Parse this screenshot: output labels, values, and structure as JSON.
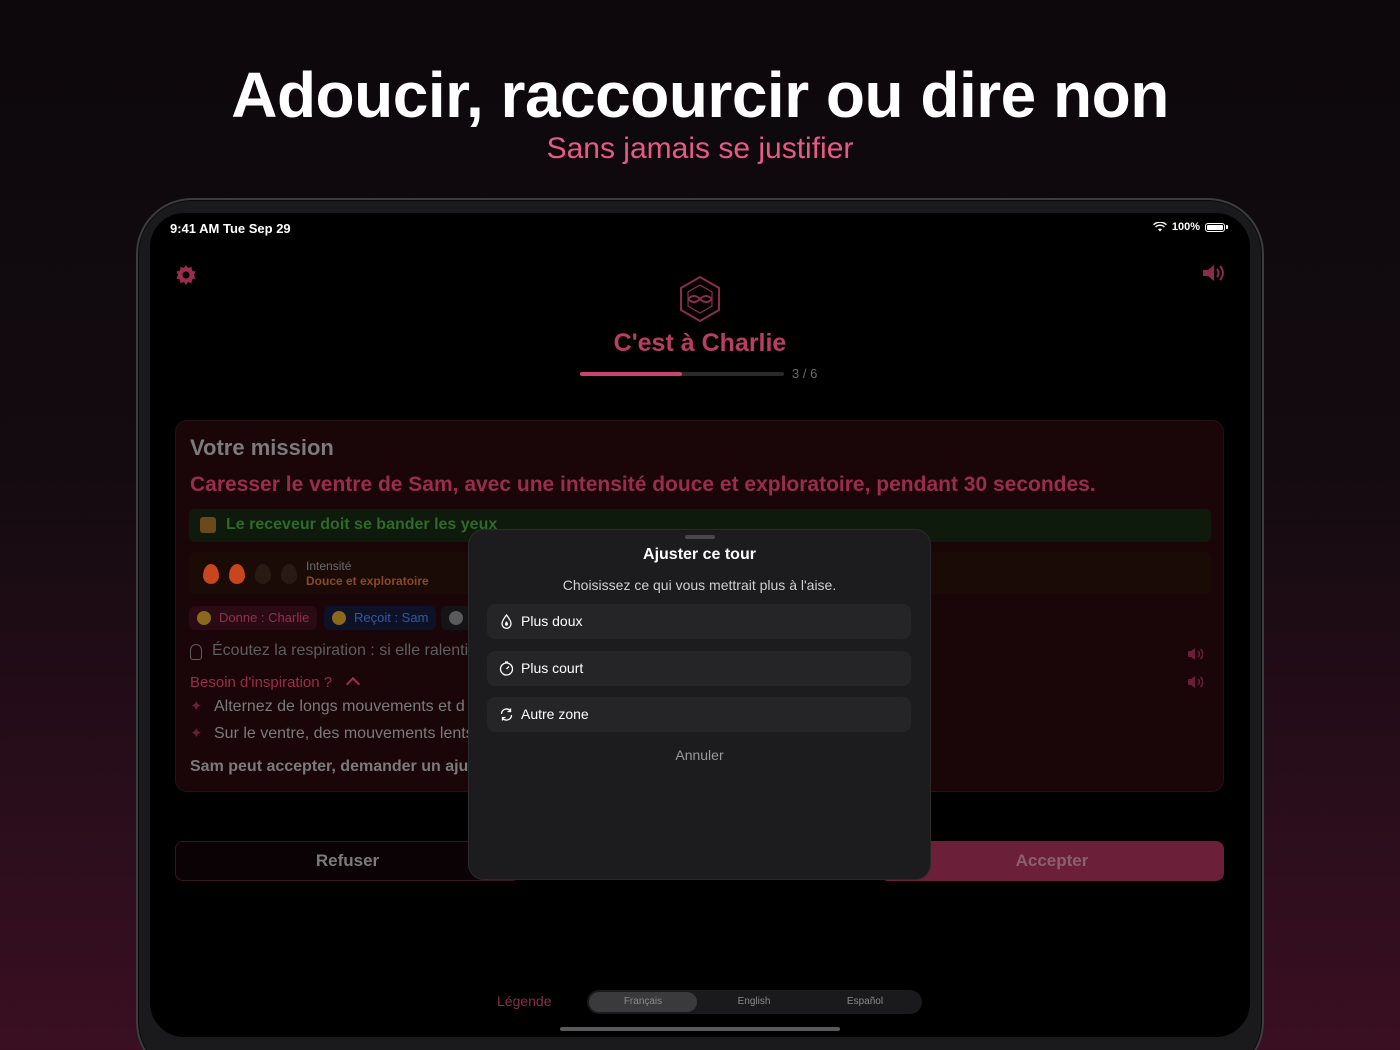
{
  "hero": {
    "title": "Adoucir, raccourcir ou dire non",
    "subtitle": "Sans jamais se justifier"
  },
  "statusbar": {
    "time": "9:41 AM  Tue Sep 29",
    "battery": "100%"
  },
  "header": {
    "turn_title": "C'est à Charlie",
    "progress_label": "3 / 6",
    "progress": 0.5
  },
  "card": {
    "title": "Votre mission",
    "mission": "Caresser le ventre de Sam, avec une intensité douce et exploratoire, pendant 30 secondes.",
    "blindfold_note": "Le receveur doit se bander les yeux",
    "intensity_label": "Intensité",
    "intensity_value": "Douce et exploratoire",
    "intensity_level": 2,
    "intensity_max": 4,
    "chip_gives": "Donne : Charlie",
    "chip_receives": "Reçoit : Sam",
    "tip": "Écoutez la respiration : si elle ralentit",
    "inspiration_title": "Besoin d'inspiration ?",
    "inspiration_items": [
      "Alternez de longs mouvements et d",
      "Sur le ventre, des mouvements lents"
    ],
    "footer": "Sam peut accepter, demander un ajus"
  },
  "actions": {
    "refuse": "Refuser",
    "accept": "Accepter"
  },
  "modal": {
    "title": "Ajuster ce tour",
    "subtitle": "Choisissez ce qui vous mettrait plus à l'aise.",
    "options": [
      {
        "label": "Plus doux",
        "icon": "drop-icon"
      },
      {
        "label": "Plus court",
        "icon": "timer-icon"
      },
      {
        "label": "Autre zone",
        "icon": "refresh-icon"
      }
    ],
    "cancel": "Annuler"
  },
  "footer": {
    "legend": "Légende",
    "languages": [
      "Français",
      "English",
      "Español"
    ],
    "active_language": "Français"
  },
  "colors": {
    "accent": "#c9456f",
    "hero_sub": "#e85a86"
  }
}
